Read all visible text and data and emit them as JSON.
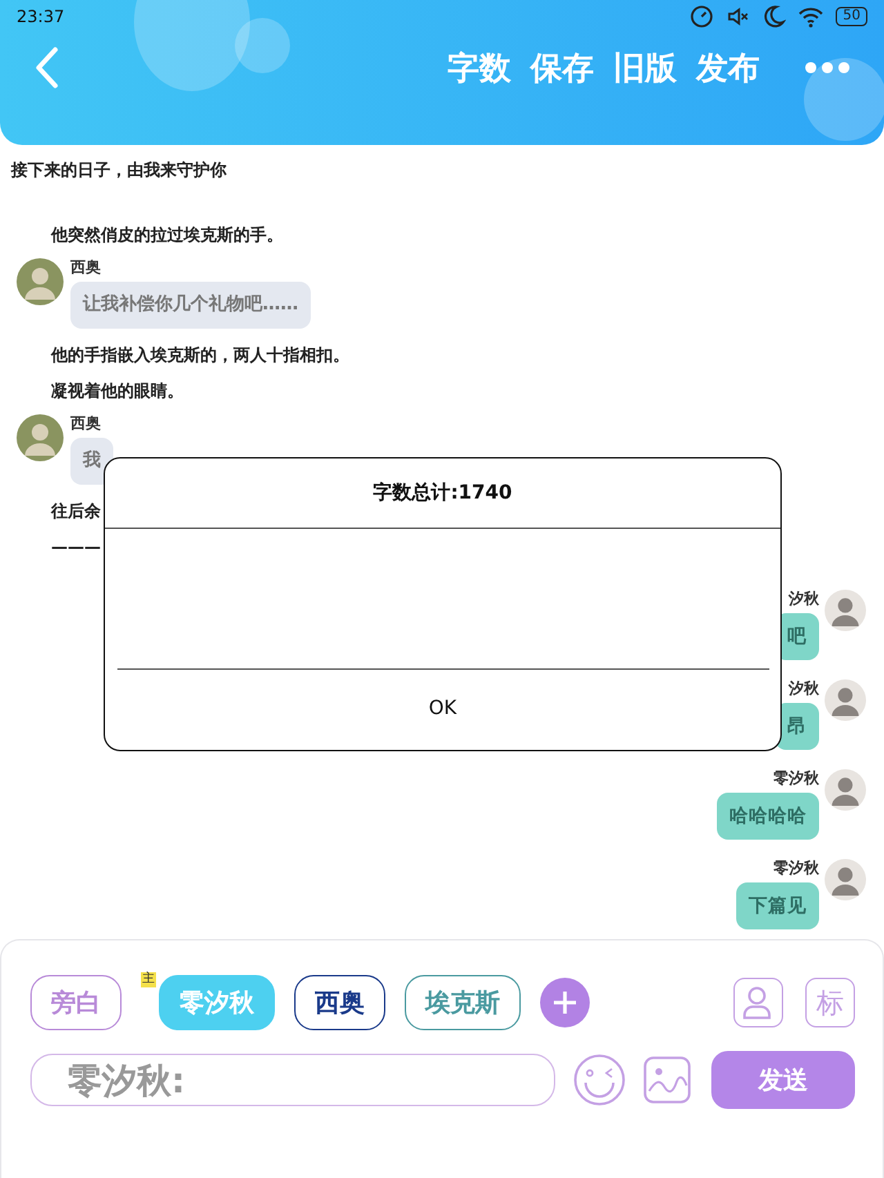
{
  "status_bar": {
    "time": "23:37",
    "battery": "50"
  },
  "header": {
    "actions": [
      {
        "label": "字数"
      },
      {
        "label": "保存"
      },
      {
        "label": "旧版"
      },
      {
        "label": "发布"
      }
    ]
  },
  "messages": [
    {
      "kind": "chapter",
      "text": "接下来的日子，由我来守护你"
    },
    {
      "kind": "narration",
      "text": "他突然俏皮的拉过埃克斯的手。"
    },
    {
      "kind": "left",
      "speaker": "西奥",
      "text": "让我补偿你几个礼物吧……"
    },
    {
      "kind": "narration",
      "text": "他的手指嵌入埃克斯的，两人十指相扣。"
    },
    {
      "kind": "narration",
      "text": "凝视着他的眼睛。"
    },
    {
      "kind": "left",
      "speaker": "西奥",
      "text": "我"
    },
    {
      "kind": "narration",
      "text": "往后余"
    },
    {
      "kind": "narration",
      "text": "———"
    },
    {
      "kind": "right",
      "speaker": "汐秋",
      "text": "吧"
    },
    {
      "kind": "right",
      "speaker": "汐秋",
      "text": "昂"
    },
    {
      "kind": "right",
      "speaker": "零汐秋",
      "text": "哈哈哈哈"
    },
    {
      "kind": "right",
      "speaker": "零汐秋",
      "text": "下篇见"
    }
  ],
  "dialog": {
    "title": "字数总计:1740",
    "button": "OK"
  },
  "characters": [
    {
      "name": "旁白",
      "color": "#b88ad8",
      "selected": false
    },
    {
      "name": "零汐秋",
      "color": "#4dd0f0",
      "selected": true,
      "badge": "主"
    },
    {
      "name": "西奥",
      "color": "#1a3a8a",
      "selected": false
    },
    {
      "name": "埃克斯",
      "color": "#4a9aa0",
      "selected": false
    }
  ],
  "tool_label": "标",
  "composer": {
    "value": "零汐秋:",
    "send": "发送"
  }
}
